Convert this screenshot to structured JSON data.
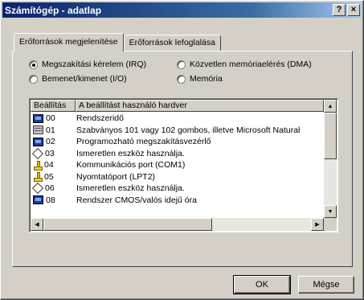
{
  "window": {
    "title": "Számítógép - adatlap",
    "help_label": "?",
    "close_label": "×"
  },
  "tabs": [
    {
      "label": "Erőforrások megjelenítése",
      "active": true
    },
    {
      "label": "Erőforrások lefoglalása",
      "active": false
    }
  ],
  "resource_types": [
    {
      "label": "Megszakítási kérelem (IRQ)",
      "checked": true
    },
    {
      "label": "Közvetlen memóriaelérés (DMA)",
      "checked": false
    },
    {
      "label": "Bemenet/kimenet (I/O)",
      "checked": false
    },
    {
      "label": "Memória",
      "checked": false
    }
  ],
  "list": {
    "columns": [
      "Beállítás",
      "A beállítást használó hardver"
    ],
    "rows": [
      {
        "icon": "monitor-icon",
        "code": "00",
        "name": "Rendszeridő"
      },
      {
        "icon": "keyboard-icon",
        "code": "01",
        "name": "Szabványos 101 vagy 102 gombos, illetve Microsoft Natural"
      },
      {
        "icon": "monitor-icon",
        "code": "02",
        "name": "Programozható megszakításvezérlő"
      },
      {
        "icon": "unknown-device-icon",
        "code": "03",
        "name": "Ismeretlen eszköz használja."
      },
      {
        "icon": "port-icon",
        "code": "04",
        "name": "Kommunikációs port (COM1)"
      },
      {
        "icon": "port-icon",
        "code": "05",
        "name": "Nyomtatóport (LPT2)"
      },
      {
        "icon": "unknown-device-icon",
        "code": "06",
        "name": "Ismeretlen eszköz használja."
      },
      {
        "icon": "monitor-icon",
        "code": "08",
        "name": "Rendszer CMOS/valós idejű óra"
      }
    ]
  },
  "scroll": {
    "up": "▲",
    "down": "▼",
    "left": "◀",
    "right": "▶"
  },
  "buttons": {
    "ok": "OK",
    "cancel": "Mégse"
  }
}
